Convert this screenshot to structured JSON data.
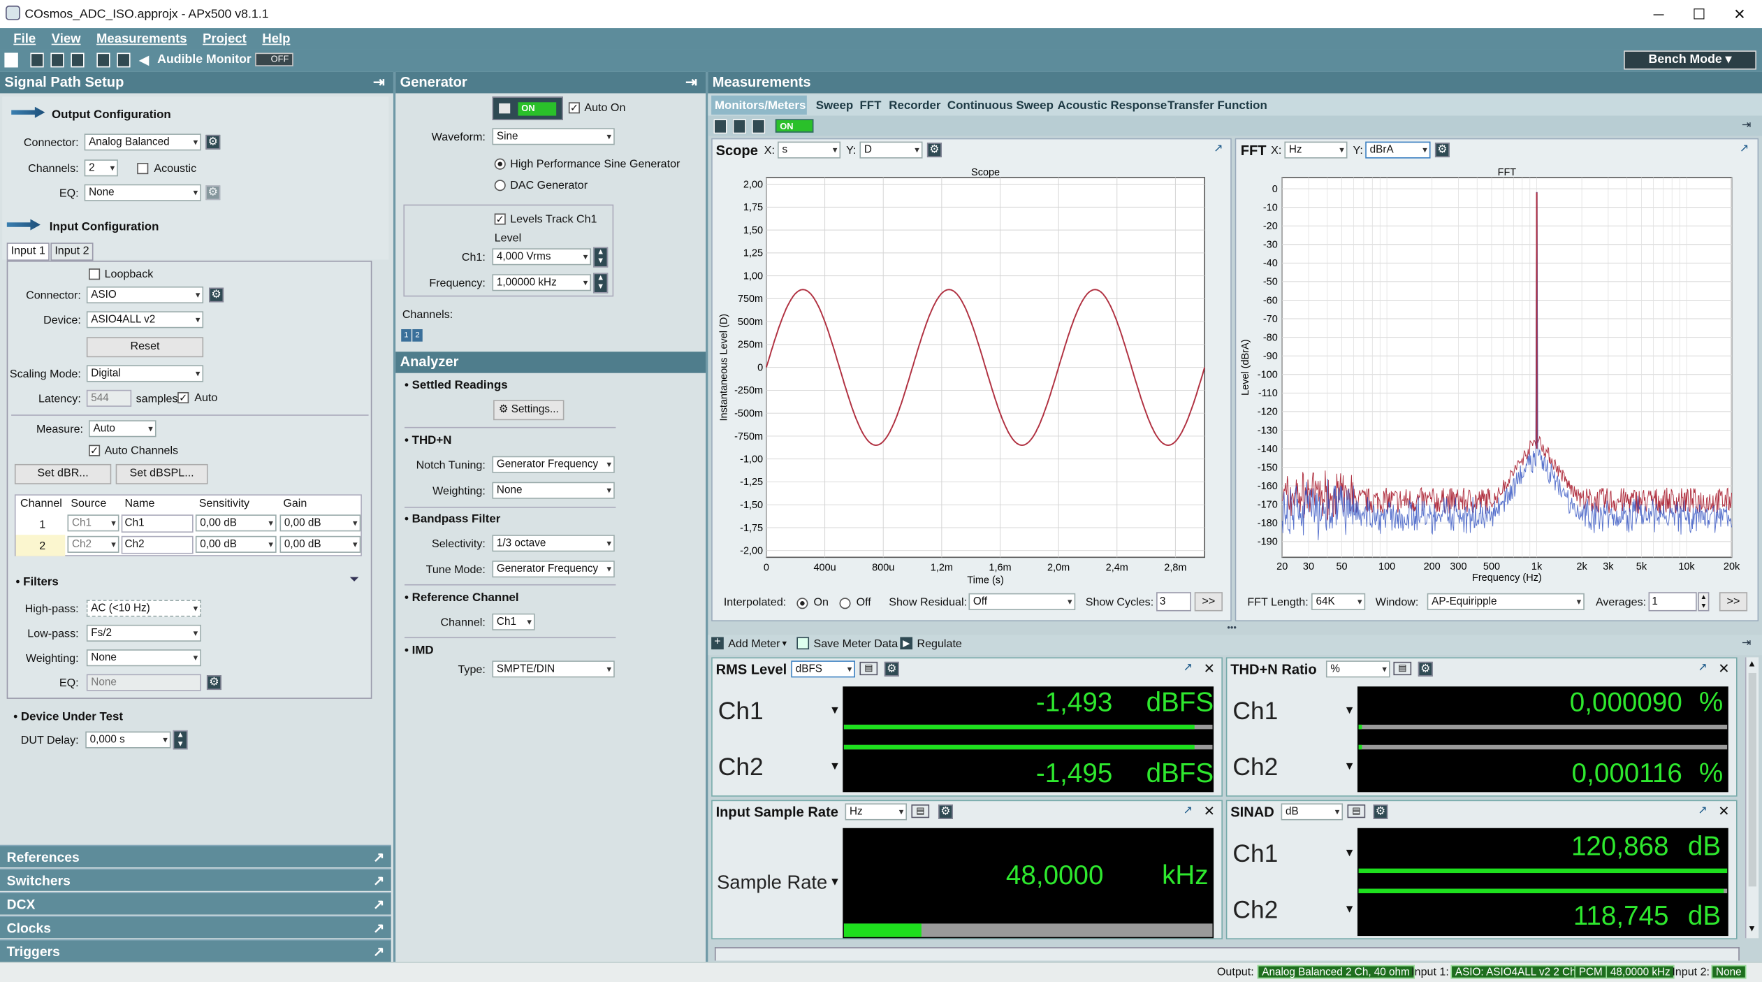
{
  "window": {
    "title": "COsmos_ADC_ISO.approjx - APx500 v8.1.1",
    "minimize": "─",
    "maximize": "☐",
    "close": "✕"
  },
  "menu": [
    "File",
    "View",
    "Measurements",
    "Project",
    "Help"
  ],
  "toolbar": {
    "audible_monitor": "Audible Monitor",
    "off": "OFF",
    "bench_mode": "Bench Mode"
  },
  "signal_path": {
    "title": "Signal Path Setup",
    "output": {
      "title": "Output Configuration",
      "connector_label": "Connector:",
      "connector": "Analog Balanced",
      "channels_label": "Channels:",
      "channels": "2",
      "acoustic": "Acoustic",
      "eq_label": "EQ:",
      "eq": "None"
    },
    "input": {
      "title": "Input Configuration",
      "tabs": [
        "Input 1",
        "Input 2"
      ],
      "loopback": "Loopback",
      "connector_label": "Connector:",
      "connector": "ASIO",
      "device_label": "Device:",
      "device": "ASIO4ALL v2",
      "reset": "Reset",
      "scaling_label": "Scaling Mode:",
      "scaling": "Digital",
      "latency_label": "Latency:",
      "latency": "544",
      "samples": "samples",
      "auto": "Auto",
      "measure_label": "Measure:",
      "measure": "Auto",
      "auto_channels": "Auto Channels",
      "set_dbr": "Set dBR...",
      "set_dbspl": "Set dBSPL...",
      "table": {
        "headers": [
          "Channel",
          "Source",
          "Name",
          "Sensitivity",
          "Gain"
        ],
        "rows": [
          [
            "1",
            "Ch1",
            "Ch1",
            "0,00 dB",
            "0,00 dB"
          ],
          [
            "2",
            "Ch2",
            "Ch2",
            "0,00 dB",
            "0,00 dB"
          ]
        ]
      }
    },
    "filters": {
      "title": "• Filters",
      "highpass_label": "High-pass:",
      "highpass": "AC (<10 Hz)",
      "lowpass_label": "Low-pass:",
      "lowpass": "Fs/2",
      "weighting_label": "Weighting:",
      "weighting": "None",
      "eq_label": "EQ:",
      "eq": "None"
    },
    "dut": {
      "title": "• Device Under Test",
      "delay_label": "DUT Delay:",
      "delay": "0,000 s"
    },
    "collapsed": [
      "References",
      "Switchers",
      "DCX",
      "Clocks",
      "Triggers"
    ]
  },
  "generator": {
    "title": "Generator",
    "on": "ON",
    "auto_on": "Auto On",
    "waveform_label": "Waveform:",
    "waveform": "Sine",
    "hp_sine": "High Performance Sine Generator",
    "dac_gen": "DAC Generator",
    "levels_track": "Levels Track Ch1",
    "level_label": "Level",
    "ch1_label": "Ch1:",
    "ch1": "4,000 Vrms",
    "freq_label": "Frequency:",
    "freq": "1,00000 kHz",
    "channels_label": "Channels:"
  },
  "analyzer": {
    "title": "Analyzer",
    "settled": "• Settled Readings",
    "settings": "Settings...",
    "thdn": "• THD+N",
    "notch_label": "Notch Tuning:",
    "notch": "Generator Frequency",
    "weighting_label": "Weighting:",
    "weighting": "None",
    "bandpass": "• Bandpass Filter",
    "selectivity_label": "Selectivity:",
    "selectivity": "1/3 octave",
    "tune_label": "Tune Mode:",
    "tune": "Generator Frequency",
    "refch": "• Reference Channel",
    "channel_label": "Channel:",
    "channel": "Ch1",
    "imd": "• IMD",
    "type_label": "Type:",
    "type": "SMPTE/DIN"
  },
  "measurements": {
    "title": "Measurements",
    "tabs": [
      "Monitors/Meters",
      "Sweep",
      "FFT",
      "Recorder",
      "Continuous Sweep",
      "Acoustic Response",
      "Transfer Function"
    ],
    "on": "ON"
  },
  "scope": {
    "title": "Scope",
    "x_label": "X:",
    "x": "s",
    "y_label": "Y:",
    "y": "D",
    "interpolated": "Interpolated:",
    "on": "On",
    "off": "Off",
    "show_residual": "Show Residual:",
    "residual": "Off",
    "show_cycles": "Show Cycles:",
    "cycles": "3",
    "more": ">>"
  },
  "fft": {
    "title": "FFT",
    "x_label": "X:",
    "x": "Hz",
    "y_label": "Y:",
    "y": "dBrA",
    "length_label": "FFT Length:",
    "length": "64K",
    "window_label": "Window:",
    "window": "AP-Equiripple",
    "averages_label": "Averages:",
    "averages": "1",
    "more": ">>"
  },
  "chart_data": [
    {
      "type": "line",
      "title": "Scope",
      "xlabel": "Time (s)",
      "ylabel": "Instantaneous Level (D)",
      "xlim": [
        0,
        0.003
      ],
      "ylim": [
        -2,
        2
      ],
      "x_ticks": [
        "0",
        "400u",
        "800u",
        "1,2m",
        "1,6m",
        "2,0m",
        "2,4m",
        "2,8m"
      ],
      "y_ticks": [
        "2,00",
        "1,75",
        "1,50",
        "1,25",
        "1,00",
        "750m",
        "500m",
        "250m",
        "0",
        "-250m",
        "-500m",
        "-750m",
        "-1,00",
        "-1,25",
        "-1,50",
        "-1,75",
        "-2,00"
      ],
      "series": [
        {
          "frequency_hz": 1000,
          "amplitude": 0.85,
          "color": "#b03040"
        }
      ],
      "grid": true
    },
    {
      "type": "line",
      "title": "FFT",
      "xlabel": "Frequency (Hz)",
      "ylabel": "Level (dBrA)",
      "xscale": "log",
      "xlim": [
        20,
        20000
      ],
      "ylim": [
        -195,
        0
      ],
      "x_ticks": [
        "20",
        "30",
        "50",
        "100",
        "200",
        "300",
        "500",
        "1k",
        "2k",
        "3k",
        "5k",
        "10k",
        "20k"
      ],
      "y_ticks": [
        "0",
        "-10",
        "-20",
        "-30",
        "-40",
        "-50",
        "-60",
        "-70",
        "-80",
        "-90",
        "-100",
        "-110",
        "-120",
        "-130",
        "-140",
        "-150",
        "-160",
        "-170",
        "-180",
        "-190"
      ],
      "peak": {
        "x": 1000,
        "y": -2
      },
      "series": [
        {
          "color": "#b03040"
        },
        {
          "color": "#3050c0"
        }
      ],
      "grid": true
    }
  ],
  "meter_toolbar": {
    "add": "Add Meter",
    "save": "Save Meter Data",
    "regulate": "Regulate"
  },
  "meters": {
    "rms": {
      "title": "RMS Level",
      "unit_sel": "dBFS",
      "ch1": "Ch1",
      "ch2": "Ch2",
      "v1": "-1,493",
      "v2": "-1,495",
      "u": "dBFS",
      "bar1": 0.95,
      "bar2": 0.95
    },
    "thdn": {
      "title": "THD+N Ratio",
      "unit_sel": "%",
      "ch1": "Ch1",
      "ch2": "Ch2",
      "v1": "0,000090",
      "v2": "0,000116",
      "u": "%",
      "bar1": 0.01,
      "bar2": 0.01
    },
    "isr": {
      "title": "Input Sample Rate",
      "unit_sel": "Hz",
      "label": "Sample Rate",
      "v": "48,0000",
      "u": "kHz",
      "bar": 0.21
    },
    "sinad": {
      "title": "SINAD",
      "unit_sel": "dB",
      "ch1": "Ch1",
      "ch2": "Ch2",
      "v1": "120,868",
      "v2": "118,745",
      "u": "dB",
      "bar1": 1,
      "bar2": 0.99
    }
  },
  "statusbar": {
    "output_label": "Output:",
    "output": "Analog Balanced 2 Ch, 40 ohm",
    "input1_label": "Input 1:",
    "input1": "ASIO: ASIO4ALL v2 2 Chs",
    "pcm": "PCM",
    "rate": "48,0000 kHz",
    "input2_label": "Input 2:",
    "input2": "None"
  }
}
